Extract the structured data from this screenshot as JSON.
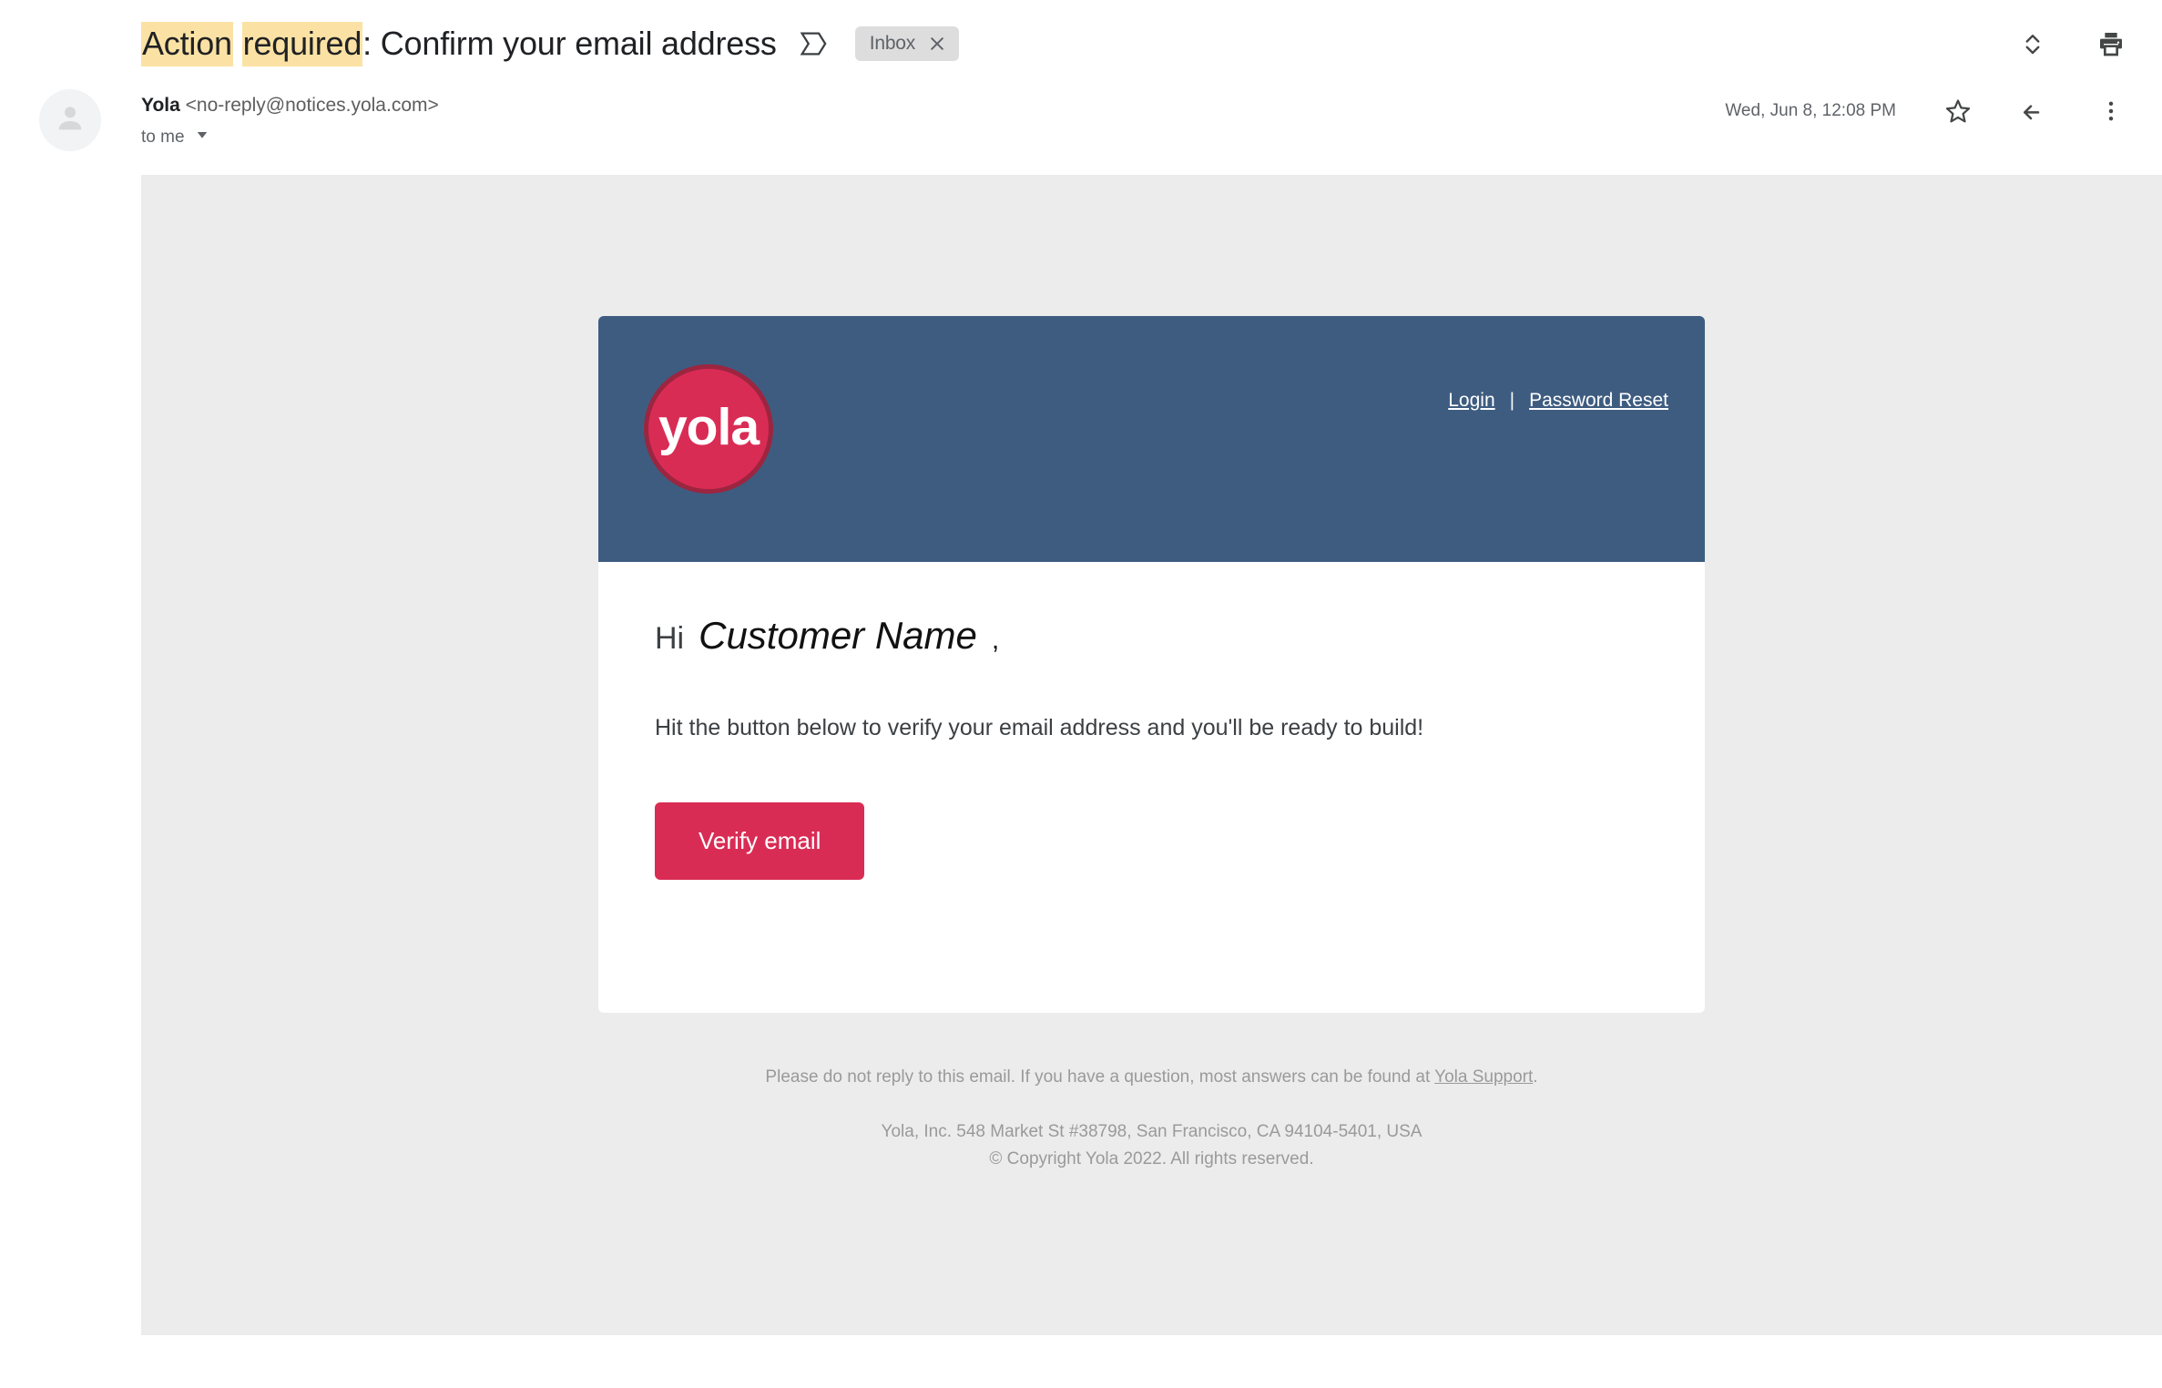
{
  "thread": {
    "subject_highlight_1": "Action",
    "subject_highlight_2": "required",
    "subject_rest": ": Confirm your email address",
    "label_chip": "Inbox",
    "expand_icon": "expand-collapse-icon",
    "print_icon": "print-icon",
    "sigma_icon": "sigma-thread-icon",
    "chip_close_icon": "close-icon"
  },
  "sender": {
    "name": "Yola",
    "email": "<no-reply@notices.yola.com>",
    "recipient": "to me",
    "timestamp": "Wed, Jun 8, 12:08 PM",
    "avatar_icon": "person-avatar-icon",
    "star_icon": "star-icon",
    "reply_icon": "reply-icon",
    "more_icon": "more-vert-icon"
  },
  "email": {
    "header": {
      "logo_text": "yola",
      "login_label": "Login",
      "separator": "|",
      "password_reset_label": "Password Reset"
    },
    "body": {
      "greeting_prefix": "Hi",
      "greeting_name": "Customer Name",
      "greeting_comma": ",",
      "paragraph": "Hit the button below to verify your email address and you'll be ready to build!",
      "cta_label": "Verify email"
    },
    "footer": {
      "note_prefix": "Please do not reply to this email. If you have a question, most answers can be found at ",
      "note_link": "Yola Support",
      "note_suffix": ".",
      "address": "Yola, Inc. 548 Market St #38798, San Francisco, CA 94104-5401, USA",
      "copyright": "© Copyright Yola 2022. All rights reserved."
    }
  },
  "colors": {
    "brand_crimson": "#d92c55",
    "header_blue": "#3e5c80",
    "highlight_yellow": "#fbe2a4",
    "body_bg": "#ececec"
  }
}
